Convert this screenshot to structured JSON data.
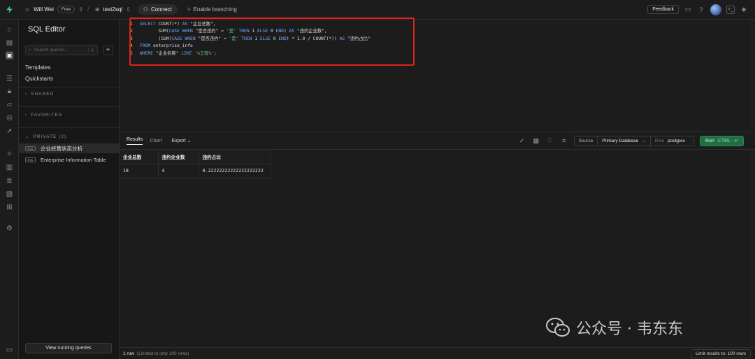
{
  "topbar": {
    "user": "Will Wei",
    "plan": "Free",
    "project": "text2sql",
    "connect": "Connect",
    "branching": "Enable branching",
    "feedback": "Feedback"
  },
  "sidebar": {
    "title": "SQL Editor",
    "search_placeholder": "Search queries...",
    "links": [
      "Templates",
      "Quickstarts"
    ],
    "sections": {
      "shared": "SHARED",
      "favorites": "FAVORITES",
      "private": "PRIVATE (2)"
    },
    "private_items": [
      {
        "tag": "SQL",
        "label": "企业经营状态分析"
      },
      {
        "tag": "SQL",
        "label": "Enterprise Information Table"
      }
    ],
    "view_running": "View running queries"
  },
  "editor": {
    "lines": [
      {
        "n": "1",
        "segs": [
          [
            "kw",
            "SELECT "
          ],
          [
            "txt",
            "COUNT(*) "
          ],
          [
            "kw",
            "AS "
          ],
          [
            "txt",
            "\"企业总数\","
          ]
        ]
      },
      {
        "n": "2",
        "segs": [
          [
            "txt",
            "       SUM("
          ],
          [
            "kw",
            "CASE WHEN "
          ],
          [
            "txt",
            "\"是否违约\" = "
          ],
          [
            "str",
            "'是' "
          ],
          [
            "kw",
            "THEN "
          ],
          [
            "txt",
            "1 "
          ],
          [
            "kw",
            "ELSE "
          ],
          [
            "txt",
            "0 "
          ],
          [
            "kw",
            "END"
          ],
          [
            "txt",
            ") "
          ],
          [
            "kw",
            "AS "
          ],
          [
            "txt",
            "\"违约企业数\","
          ]
        ]
      },
      {
        "n": "3",
        "segs": [
          [
            "txt",
            "       (SUM("
          ],
          [
            "kw",
            "CASE WHEN "
          ],
          [
            "txt",
            "\"是否违约\" = "
          ],
          [
            "str",
            "'是' "
          ],
          [
            "kw",
            "THEN "
          ],
          [
            "txt",
            "1 "
          ],
          [
            "kw",
            "ELSE "
          ],
          [
            "txt",
            "0 "
          ],
          [
            "kw",
            "END"
          ],
          [
            "txt",
            ") * 1.0 / COUNT(*)) "
          ],
          [
            "kw",
            "AS "
          ],
          [
            "txt",
            "\"违约占比\""
          ]
        ]
      },
      {
        "n": "4",
        "segs": [
          [
            "kw",
            "FROM "
          ],
          [
            "txt",
            "enterprise_info"
          ]
        ]
      },
      {
        "n": "5",
        "segs": [
          [
            "kw",
            "WHERE "
          ],
          [
            "txt",
            "\"企业名称\" "
          ],
          [
            "kw",
            "LIKE "
          ],
          [
            "str",
            "'%工程%'"
          ],
          [
            "txt",
            ";"
          ]
        ]
      }
    ]
  },
  "results": {
    "tabs": [
      "Results",
      "Chart",
      "Export"
    ],
    "source_label": "Source",
    "database": "Primary Database",
    "role_label": "Role",
    "role": "postgres",
    "run_label": "Run",
    "run_shortcut": "CTRL",
    "columns": [
      "企业总数",
      "违约企业数",
      "违约占比"
    ],
    "rows": [
      [
        "18",
        "4",
        "0.22222222222222222222"
      ]
    ]
  },
  "status": {
    "rows": "1 row",
    "limit_note": "(Limited to only 100 rows)",
    "limit_button": "Limit results to: 100 rows"
  },
  "watermark": {
    "text": "公众号 · 韦东东"
  },
  "colors": {
    "accent": "#3ecf8e",
    "highlight": "#e0201e",
    "run": "#1f6f43"
  }
}
